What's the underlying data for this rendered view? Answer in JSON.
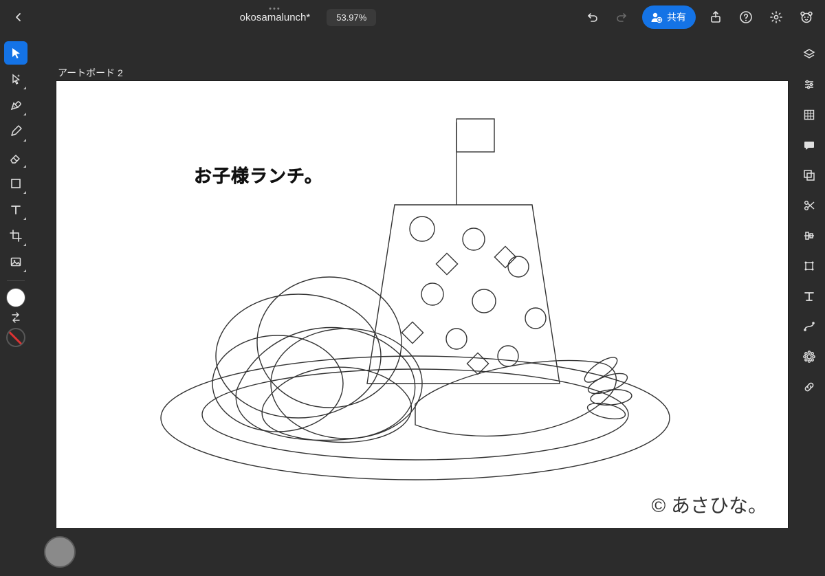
{
  "header": {
    "document_title": "okosamalunch*",
    "zoom_label": "53.97%",
    "share_label": "共有"
  },
  "artboard": {
    "label": "アートボード 2",
    "title_text": "お子様ランチ。",
    "credit_text": "© あさひな。"
  },
  "left_tools": [
    {
      "name": "selection-tool",
      "icon": "cursor",
      "active": true,
      "sub": false
    },
    {
      "name": "direct-selection-tool",
      "icon": "sparkle-cursor",
      "active": false,
      "sub": true
    },
    {
      "name": "pen-tool",
      "icon": "pen",
      "active": false,
      "sub": true
    },
    {
      "name": "pencil-tool",
      "icon": "pencil",
      "active": false,
      "sub": true
    },
    {
      "name": "eraser-tool",
      "icon": "eraser",
      "active": false,
      "sub": true
    },
    {
      "name": "shape-tool",
      "icon": "rect",
      "active": false,
      "sub": true
    },
    {
      "name": "type-tool",
      "icon": "type",
      "active": false,
      "sub": true
    },
    {
      "name": "artboard-tool",
      "icon": "crop",
      "active": false,
      "sub": true
    },
    {
      "name": "place-image-tool",
      "icon": "image",
      "active": false,
      "sub": true
    }
  ],
  "right_tools": [
    {
      "name": "layers-panel",
      "icon": "layers"
    },
    {
      "name": "properties-panel",
      "icon": "sliders"
    },
    {
      "name": "precision-panel",
      "icon": "grid"
    },
    {
      "name": "comment-panel",
      "icon": "comment"
    },
    {
      "name": "combine-panel",
      "icon": "combine"
    },
    {
      "name": "scissors-panel",
      "icon": "scissors"
    },
    {
      "name": "align-panel",
      "icon": "align"
    },
    {
      "name": "transform-panel",
      "icon": "transform"
    },
    {
      "name": "text-panel",
      "icon": "text-panel"
    },
    {
      "name": "path-panel",
      "icon": "path"
    },
    {
      "name": "effects-panel",
      "icon": "gear-flower"
    },
    {
      "name": "link-panel",
      "icon": "link"
    }
  ],
  "colors": {
    "fill": "#ffffff",
    "stroke": "none",
    "puck": "#8a8a8a",
    "accent": "#1473e6"
  }
}
